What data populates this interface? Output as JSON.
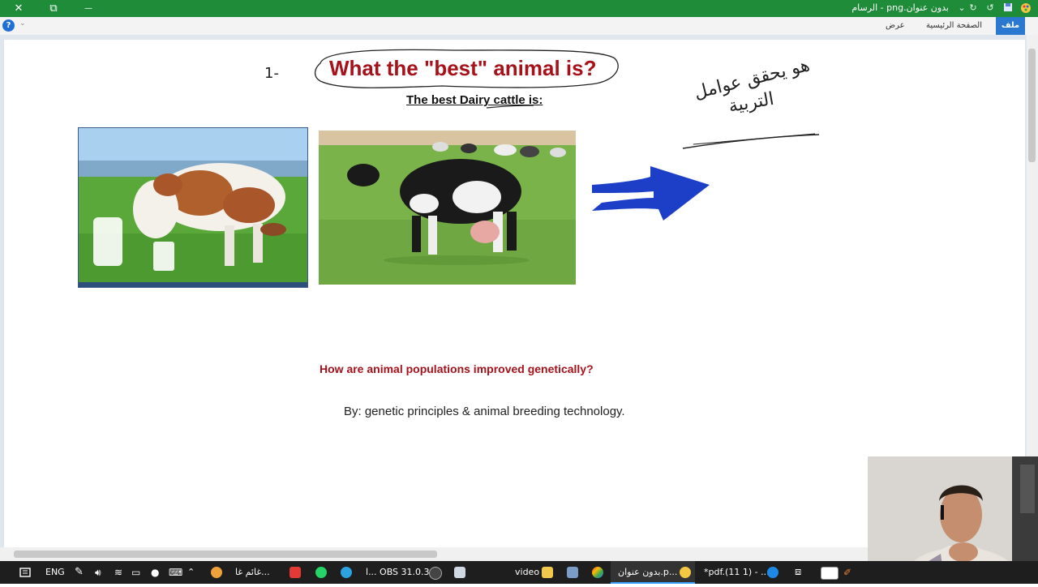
{
  "window": {
    "title": "بدون عنوان.png - الرسام",
    "close_glyph": "✕",
    "restore_glyph": "⧉",
    "minimize_glyph": "—"
  },
  "quick_access": [
    "save-icon",
    "undo-icon",
    "redo-icon",
    "customize-icon"
  ],
  "ribbon": {
    "help": "?",
    "tabs": [
      {
        "label": "ملف"
      },
      {
        "label": "الصفحة الرئيسية"
      },
      {
        "label": "عرض"
      }
    ]
  },
  "slide": {
    "number_mark": "1-",
    "title": "What the \"best\" animal is?",
    "subtitle": "The best Dairy cattle is:",
    "question": "How are animal populations improved genetically?",
    "answer": "By: genetic principles & animal breeding technology.",
    "handwriting": [
      "هو يحقق عوامل",
      "التربية"
    ]
  },
  "colors": {
    "titlebar": "#1f8c3a",
    "title_red": "#a6111a",
    "arrow_blue": "#1d3fc8",
    "file_tab": "#2b78d0",
    "taskbar": "#1e1e1e"
  },
  "taskbar": {
    "language": "ENG",
    "items": [
      {
        "label": "غائم غا..."
      },
      {
        "label": "ا... OBS 31.0.3"
      },
      {
        "label": "video"
      },
      {
        "label": "بدون عنوان.p..."
      },
      {
        "label": "*pdf.(11 1) - ..."
      }
    ]
  }
}
